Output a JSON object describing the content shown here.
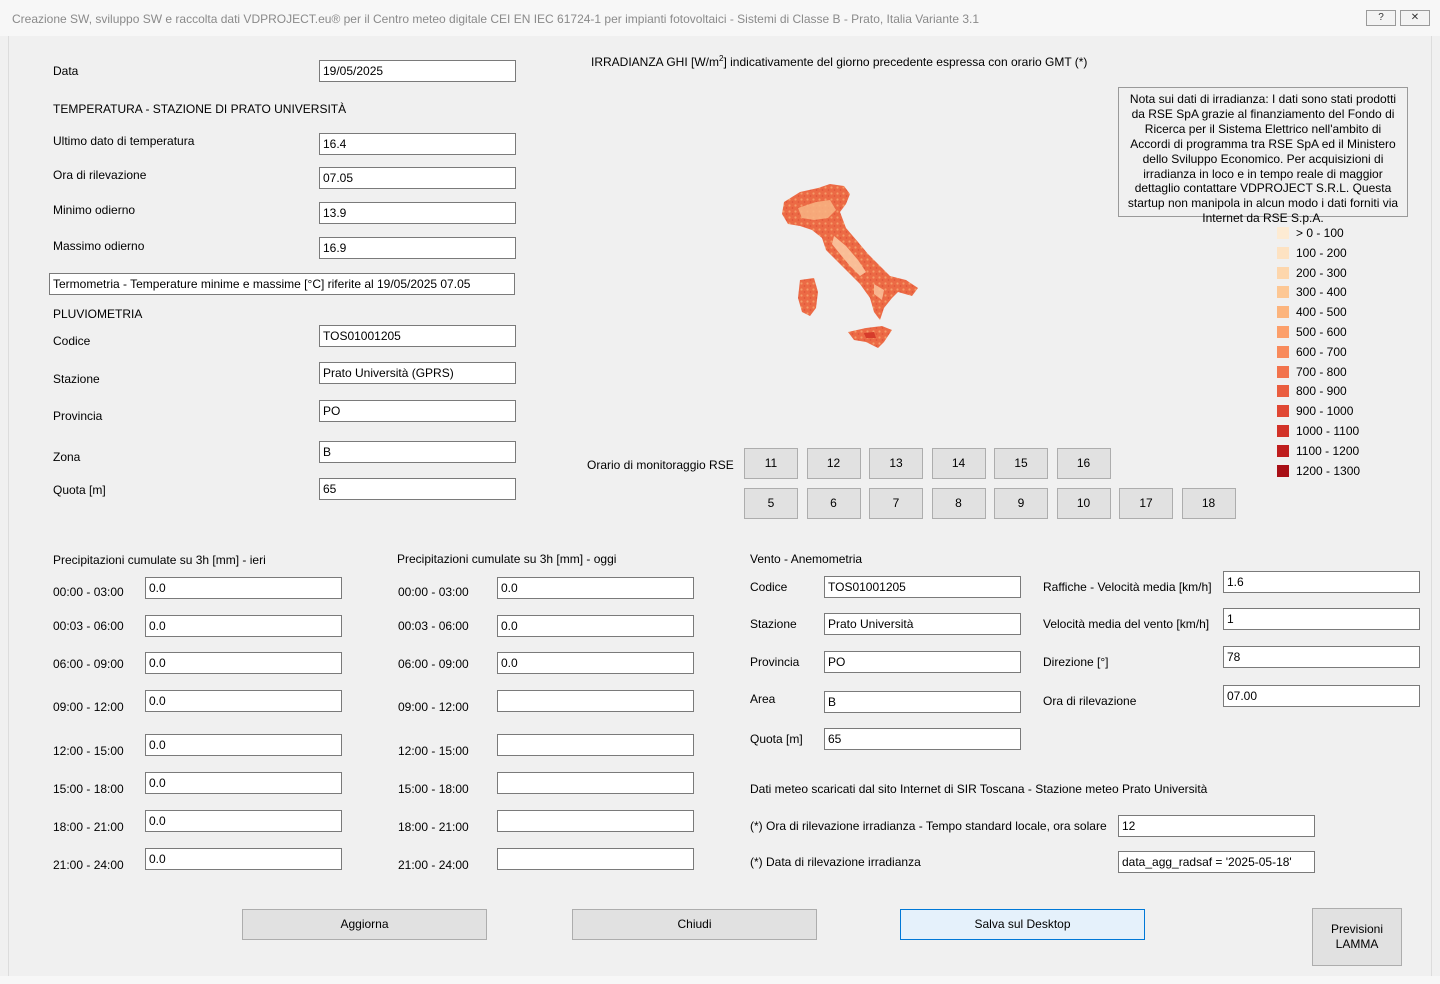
{
  "window": {
    "title": "Creazione SW, sviluppo SW e raccolta dati VDPROJECT.eu® per il Centro meteo digitale CEI EN IEC 61724-1 per impianti fotovoltaici - Sistemi di Classe B - Prato, Italia   Variante 3.1",
    "help_label": "?",
    "close_label": "✕"
  },
  "data_field": {
    "label": "Data",
    "value": "19/05/2025"
  },
  "temperatura": {
    "heading": "TEMPERATURA - STAZIONE DI PRATO UNIVERSITÀ",
    "ultimo_label": "Ultimo dato di temperatura",
    "ultimo_value": "16.4",
    "ora_label": "Ora di rilevazione",
    "ora_value": "07.05",
    "min_label": "Minimo odierno",
    "min_value": "13.9",
    "max_label": "Massimo odierno",
    "max_value": "16.9",
    "summary": "Termometria - Temperature minime e massime [°C] riferite al 19/05/2025 07.05"
  },
  "pluviometria": {
    "heading": "PLUVIOMETRIA",
    "codice_label": "Codice",
    "codice_value": "TOS01001205",
    "stazione_label": "Stazione",
    "stazione_value": "Prato Università (GPRS)",
    "provincia_label": "Provincia",
    "provincia_value": "PO",
    "zona_label": "Zona",
    "zona_value": "B",
    "quota_label": "Quota [m]",
    "quota_value": "65"
  },
  "irradianza": {
    "title_pre": "IRRADIANZA GHI [W/m",
    "title_sup": "2",
    "title_post": "] indicativamente del giorno precedente espressa con orario GMT (*)",
    "note": "Nota sui dati di irradianza: I dati sono stati prodotti da RSE SpA grazie al finanziamento del Fondo di Ricerca per il Sistema Elettrico nell'ambito di Accordi di programma tra RSE SpA ed il Ministero dello Sviluppo Economico. Per acquisizioni di irradianza in loco e in tempo reale di maggior dettaglio contattare VDPROJECT S.R.L. Questa startup non manipola in alcun modo i dati forniti via Internet da RSE S.p.A.",
    "legend": [
      {
        "label": "> 0 - 100",
        "color": "#fdebd3"
      },
      {
        "label": "100 - 200",
        "color": "#fde2c2"
      },
      {
        "label": "200 - 300",
        "color": "#fdd6ac"
      },
      {
        "label": "300 - 400",
        "color": "#fdc794"
      },
      {
        "label": "400 - 500",
        "color": "#fcb47d"
      },
      {
        "label": "500 - 600",
        "color": "#fc9f6a"
      },
      {
        "label": "600 - 700",
        "color": "#f88a5b"
      },
      {
        "label": "700 - 800",
        "color": "#f2734c"
      },
      {
        "label": "800 - 900",
        "color": "#ea5d3f"
      },
      {
        "label": "900 - 1000",
        "color": "#e04733"
      },
      {
        "label": "1000 - 1100",
        "color": "#d23228"
      },
      {
        "label": "1100 - 1200",
        "color": "#bf1d1d"
      },
      {
        "label": "1200 - 1300",
        "color": "#a80f16"
      }
    ],
    "orario_label": "Orario di monitoraggio RSE",
    "hours_row1": [
      "11",
      "12",
      "13",
      "14",
      "15",
      "16"
    ],
    "hours_row2": [
      "5",
      "6",
      "7",
      "8",
      "9",
      "10",
      "17",
      "18"
    ]
  },
  "ieri": {
    "heading": "Precipitazioni cumulate su 3h [mm] - ieri",
    "rows": [
      {
        "label": "00:00 - 03:00",
        "value": "0.0"
      },
      {
        "label": "00:03 - 06:00",
        "value": "0.0"
      },
      {
        "label": "06:00 - 09:00",
        "value": "0.0"
      },
      {
        "label": "09:00 - 12:00",
        "value": "0.0"
      },
      {
        "label": "12:00 - 15:00",
        "value": "0.0"
      },
      {
        "label": "15:00 - 18:00",
        "value": "0.0"
      },
      {
        "label": "18:00 - 21:00",
        "value": "0.0"
      },
      {
        "label": "21:00 - 24:00",
        "value": "0.0"
      }
    ]
  },
  "oggi": {
    "heading": "Precipitazioni cumulate su 3h [mm] - oggi",
    "rows": [
      {
        "label": "00:00 - 03:00",
        "value": "0.0"
      },
      {
        "label": "00:03 - 06:00",
        "value": "0.0"
      },
      {
        "label": "06:00 - 09:00",
        "value": "0.0"
      },
      {
        "label": "09:00 - 12:00",
        "value": ""
      },
      {
        "label": "12:00 - 15:00",
        "value": ""
      },
      {
        "label": "15:00 - 18:00",
        "value": ""
      },
      {
        "label": "18:00 - 21:00",
        "value": ""
      },
      {
        "label": "21:00 - 24:00",
        "value": ""
      }
    ]
  },
  "vento": {
    "heading": "Vento - Anemometria",
    "codice_label": "Codice",
    "codice_value": "TOS01001205",
    "stazione_label": "Stazione",
    "stazione_value": "Prato Università",
    "provincia_label": "Provincia",
    "provincia_value": "PO",
    "area_label": "Area",
    "area_value": "B",
    "quota_label": "Quota [m]",
    "quota_value": "65",
    "raffiche_label": "Raffiche - Velocità media [km/h]",
    "raffiche_value": "1.6",
    "velocita_label": "Velocità media del vento [km/h]",
    "velocita_value": "1",
    "direzione_label": "Direzione [°]",
    "direzione_value": "78",
    "ora_label": "Ora di rilevazione",
    "ora_value": "07.00"
  },
  "fonte": {
    "text": "Dati meteo scaricati dal sito Internet di SIR Toscana - Stazione meteo Prato Università",
    "ora_irr_label": "(*) Ora di rilevazione irradianza - Tempo standard locale, ora solare",
    "ora_irr_value": "12",
    "data_irr_label": "(*) Data di rilevazione irradianza",
    "data_irr_value": "data_agg_radsaf = '2025-05-18'"
  },
  "buttons": {
    "aggiorna": "Aggiorna",
    "chiudi": "Chiudi",
    "salva": "Salva sul Desktop",
    "previsioni_line1": "Previsioni",
    "previsioni_line2": "LAMMA"
  }
}
